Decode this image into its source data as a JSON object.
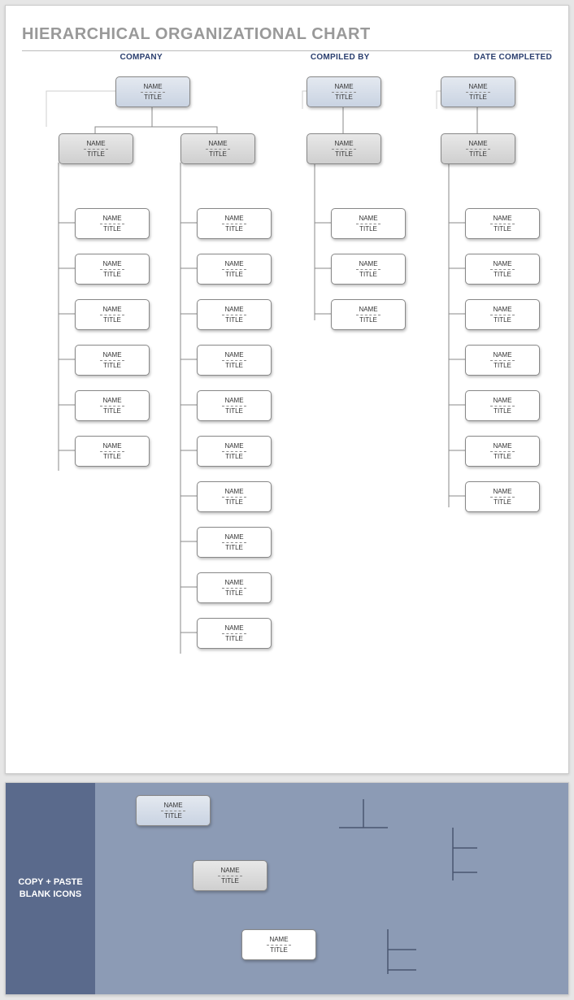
{
  "title": "HIERARCHICAL ORGANIZATIONAL CHART",
  "headers": {
    "company": "COMPANY",
    "compiled_by": "COMPILED BY",
    "date": "DATE COMPLETED"
  },
  "labels": {
    "name": "NAME",
    "title": "TITLE"
  },
  "copy_paste": "COPY + PASTE BLANK ICONS"
}
